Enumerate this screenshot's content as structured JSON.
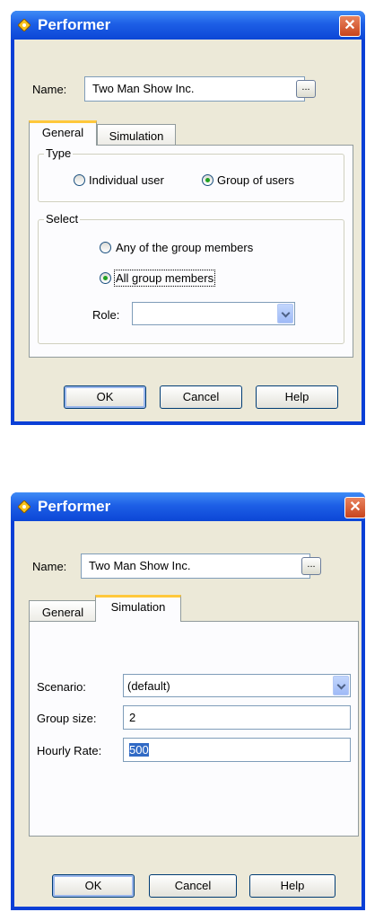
{
  "dialog1": {
    "title": "Performer",
    "close": "✕",
    "name_label": "Name:",
    "name_value": "Two Man Show Inc.",
    "browse_label": "...",
    "tabs": [
      {
        "label": "General"
      },
      {
        "label": "Simulation"
      }
    ],
    "type_group": {
      "legend": "Type",
      "options": [
        {
          "label": "Individual user",
          "checked": false
        },
        {
          "label": "Group of users",
          "checked": true
        }
      ]
    },
    "select_group": {
      "legend": "Select",
      "options": [
        {
          "label": "Any of the group members",
          "checked": false
        },
        {
          "label": "All group members",
          "checked": true
        }
      ],
      "role_label": "Role:",
      "role_value": ""
    },
    "buttons": {
      "ok": "OK",
      "cancel": "Cancel",
      "help": "Help"
    }
  },
  "dialog2": {
    "title": "Performer",
    "close": "✕",
    "name_label": "Name:",
    "name_value": "Two Man Show Inc.",
    "browse_label": "...",
    "tabs": [
      {
        "label": "General"
      },
      {
        "label": "Simulation"
      }
    ],
    "scenario_label": "Scenario:",
    "scenario_value": "(default)",
    "group_size_label": "Group size:",
    "group_size_value": "2",
    "hourly_rate_label": "Hourly Rate:",
    "hourly_rate_value": "500",
    "buttons": {
      "ok": "OK",
      "cancel": "Cancel",
      "help": "Help"
    }
  },
  "colors": {
    "title_bar": "#0c46d6",
    "tab_accent": "#ffc83c",
    "selection": "#316ac5",
    "radio_dot": "#21a121"
  },
  "icons": [
    "performer-icon",
    "close-icon",
    "chevron-down-icon"
  ]
}
